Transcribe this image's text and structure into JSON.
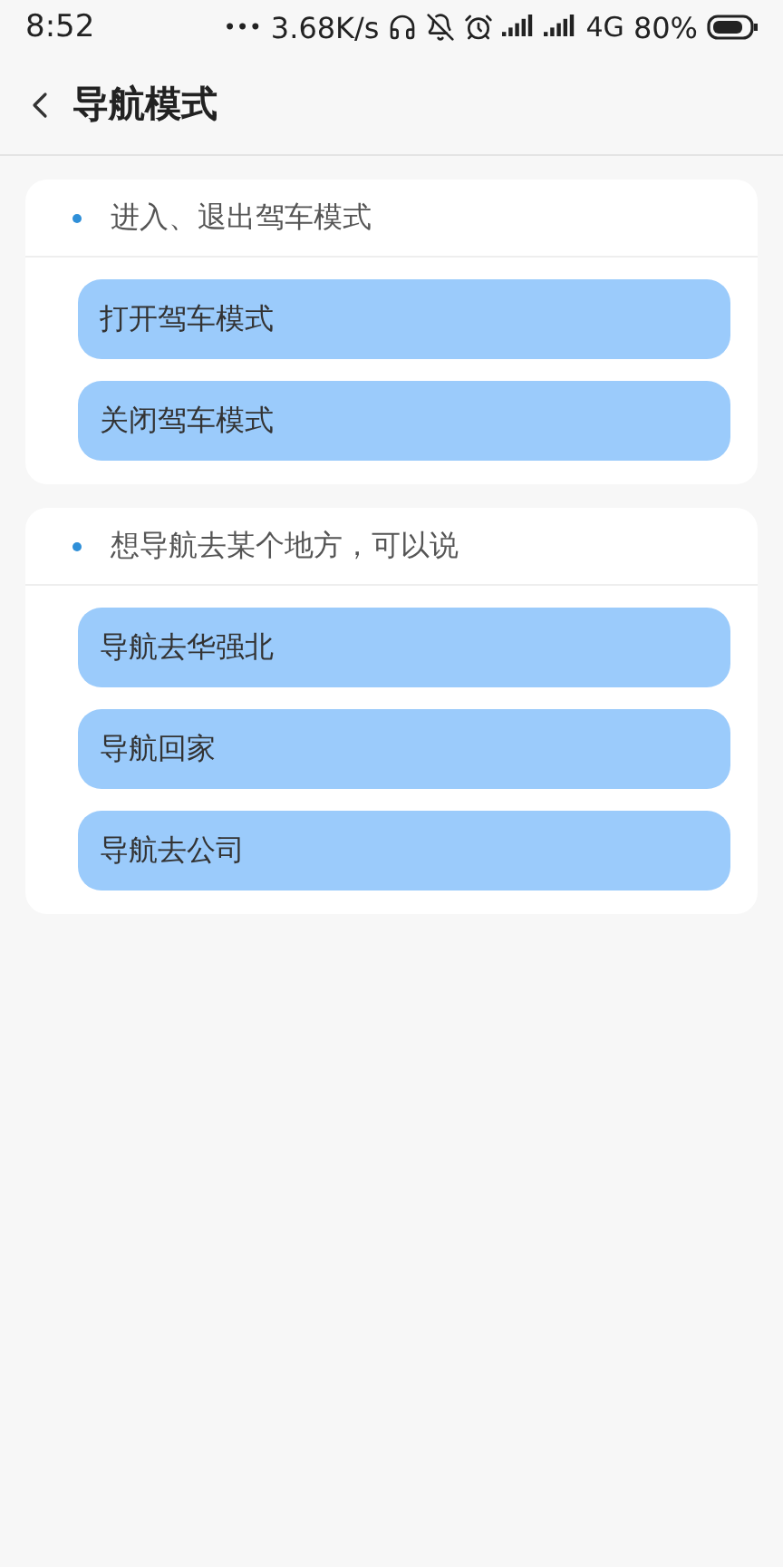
{
  "status_bar": {
    "time": "8:52",
    "more": "•••",
    "network_speed": "3.68K/s",
    "network_type": "4G",
    "battery": "80%"
  },
  "header": {
    "title": "导航模式"
  },
  "sections": [
    {
      "heading": "进入、退出驾车模式",
      "commands": [
        "打开驾车模式",
        "关闭驾车模式"
      ]
    },
    {
      "heading": "想导航去某个地方，可以说",
      "commands": [
        "导航去华强北",
        "导航回家",
        "导航去公司"
      ]
    }
  ]
}
